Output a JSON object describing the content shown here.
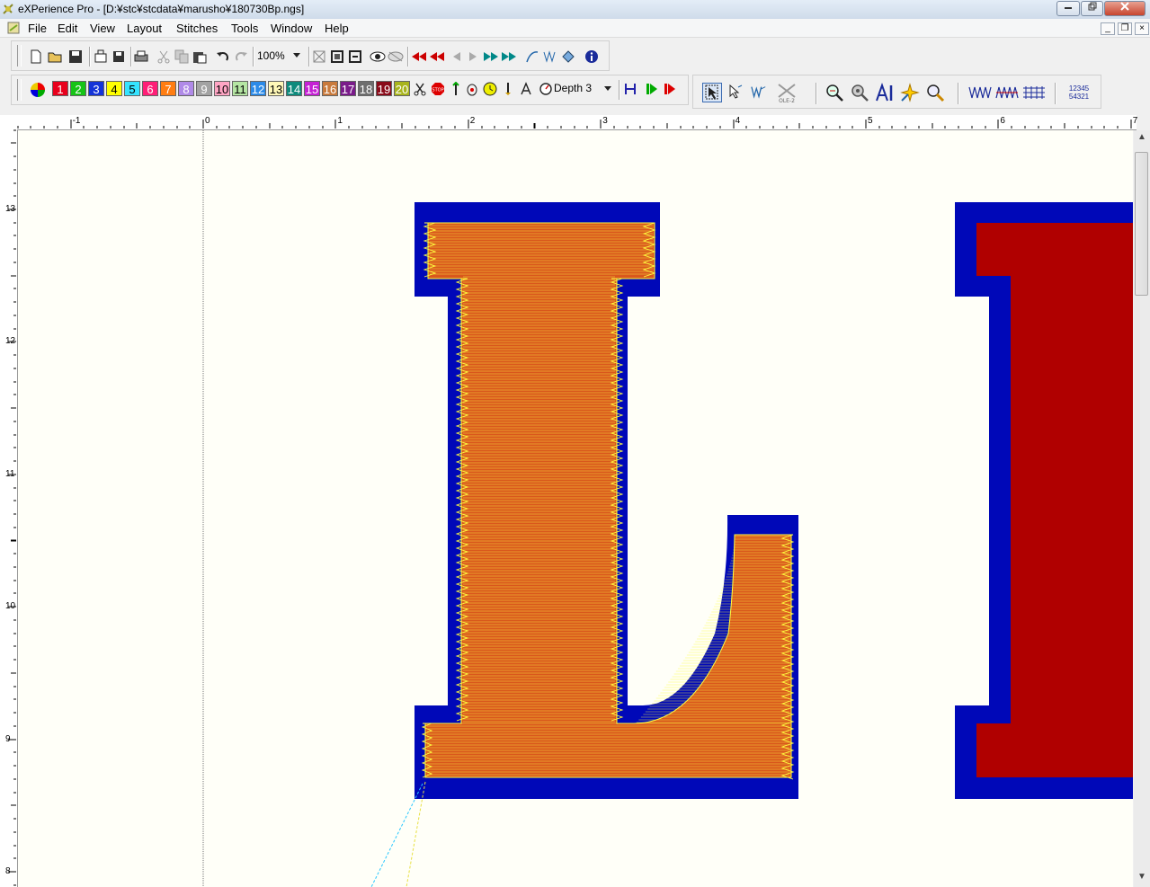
{
  "window": {
    "title": "eXPerience Pro - [D:¥stc¥stcdata¥marusho¥180730Bp.ngs]"
  },
  "menu": {
    "items": [
      "File",
      "Edit",
      "View",
      "Layout",
      "Stitches",
      "Tools",
      "Window",
      "Help"
    ]
  },
  "toolbar": {
    "zoom": "100%",
    "depth": "Depth 3",
    "swatches": [
      {
        "label": "1",
        "color": "#e8001c"
      },
      {
        "label": "2",
        "color": "#16c416"
      },
      {
        "label": "3",
        "color": "#1433d8"
      },
      {
        "label": "4",
        "color": "#ffff00"
      },
      {
        "label": "5",
        "color": "#35e3ff"
      },
      {
        "label": "6",
        "color": "#ff1f77"
      },
      {
        "label": "7",
        "color": "#ff7d12"
      },
      {
        "label": "8",
        "color": "#b08ae8"
      },
      {
        "label": "9",
        "color": "#a3a3a3"
      },
      {
        "label": "10",
        "color": "#ffa5c4"
      },
      {
        "label": "11",
        "color": "#b5e6a3"
      },
      {
        "label": "12",
        "color": "#2b8ae8"
      },
      {
        "label": "13",
        "color": "#fff8b8"
      },
      {
        "label": "14",
        "color": "#0e8a7c"
      },
      {
        "label": "15",
        "color": "#c521d4"
      },
      {
        "label": "16",
        "color": "#c97a3c"
      },
      {
        "label": "17",
        "color": "#7a1b8a"
      },
      {
        "label": "18",
        "color": "#6e6e6e"
      },
      {
        "label": "19",
        "color": "#8a0b1a"
      },
      {
        "label": "20",
        "color": "#a8b41c"
      }
    ],
    "seq_label": "12345\n54321"
  },
  "ruler": {
    "h_labels": [
      "-1",
      "0",
      "1",
      "2",
      "3",
      "4",
      "5",
      "6",
      "7"
    ],
    "v_labels": [
      "13",
      "12",
      "11",
      "10",
      "9",
      "8"
    ]
  },
  "colors": {
    "outline_blue": "#0008b8",
    "fill_red": "#b00000",
    "stitch_orange": "#d9571c",
    "stitch_yellow": "#ffff40",
    "canvas_bg": "#fffff8"
  }
}
